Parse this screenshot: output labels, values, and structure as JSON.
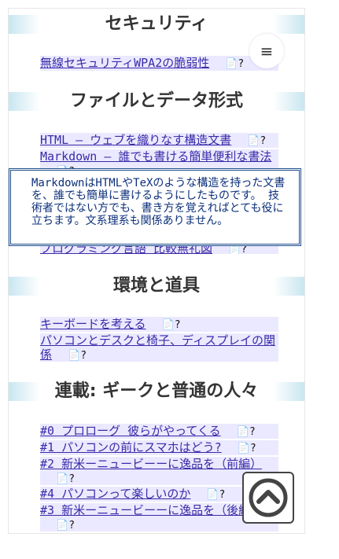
{
  "sections": [
    {
      "title": "セキュリティ"
    },
    {
      "title": "ファイルとデータ形式"
    },
    {
      "title": "環境と道具"
    },
    {
      "title": "連載: ギークと普通の人々"
    }
  ],
  "note_icon": {
    "glyph": "📄",
    "mark": "?"
  },
  "security_links": [
    {
      "label": "無線セキュリティWPA2の脆弱性"
    }
  ],
  "file_links": [
    {
      "label": "HTML – ウェブを織りなす構造文書"
    },
    {
      "label": "Markdown – 誰でも書ける簡単便利な書法"
    },
    {
      "label": "プログラミング言語 比較無礼図"
    }
  ],
  "env_links": [
    {
      "label": "キーボードを考える"
    },
    {
      "label": "パソコンとデスクと椅子、ディスプレイの関係"
    }
  ],
  "series_links": [
    {
      "label": "#0 プロローグ 彼らがやってくる"
    },
    {
      "label": "#1 パソコンの前にスマホはどう?"
    },
    {
      "label": "#2 新米ーニュービーーに逸品を（前編）"
    },
    {
      "label": "#4 パソコンって楽しいのか"
    },
    {
      "label": "#3 新米ーニュービーーに逸品を（後編）"
    }
  ],
  "tooltip": {
    "text": "MarkdownはHTMLやTeXのような構造を持った文書を、誰でも簡単に書けるようにしたものです。 技術者ではない方でも、書き方を覚えればとても役に立ちます。文系理系も関係ありません。"
  },
  "menu_button": {
    "icon": "hamburger-icon",
    "glyph": "≡"
  },
  "back_to_top": {
    "icon": "chevron-up-circle-icon"
  }
}
